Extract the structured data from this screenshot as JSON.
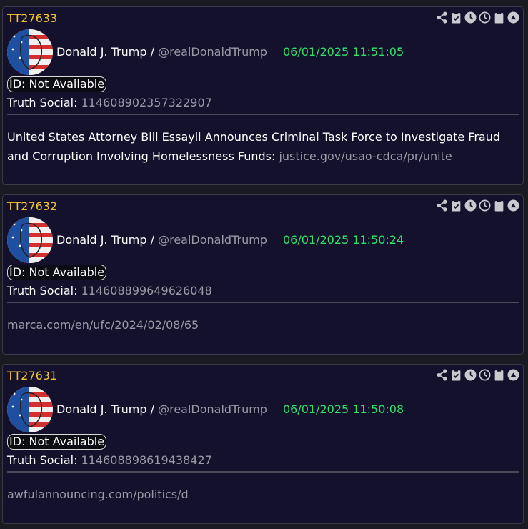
{
  "posts": [
    {
      "id": "TT27633",
      "author": "Donald J. Trump /",
      "handle": "@realDonaldTrump",
      "timestamp": "06/01/2025 11:51:05",
      "id_badge": "ID: Not Available",
      "social_label": "Truth Social:",
      "social_id": "114608902357322907",
      "text": "United States Attorney Bill Essayli Announces Criminal Task Force to Investigate Fraud and Corruption Involving Homelessness Funds: ",
      "link": "justice.gov/usao-cdca/pr/unite"
    },
    {
      "id": "TT27632",
      "author": "Donald J. Trump /",
      "handle": "@realDonaldTrump",
      "timestamp": "06/01/2025 11:50:24",
      "id_badge": "ID: Not Available",
      "social_label": "Truth Social:",
      "social_id": "114608899649626048",
      "text": "",
      "link": "marca.com/en/ufc/2024/02/08/65"
    },
    {
      "id": "TT27631",
      "author": "Donald J. Trump /",
      "handle": "@realDonaldTrump",
      "timestamp": "06/01/2025 11:50:08",
      "id_badge": "ID: Not Available",
      "social_label": "Truth Social:",
      "social_id": "114608898619438427",
      "text": "",
      "link": "awfulannouncing.com/politics/d"
    }
  ],
  "actions": [
    "share-icon",
    "clipboard-check-icon",
    "clock-filled-icon",
    "clock-outline-icon",
    "clipboard-icon",
    "chevron-up-circle-icon"
  ],
  "colors": {
    "id": "#f4c430",
    "timestamp": "#2ee26b",
    "muted": "#9a9aa6",
    "card_bg": "#13112b"
  }
}
